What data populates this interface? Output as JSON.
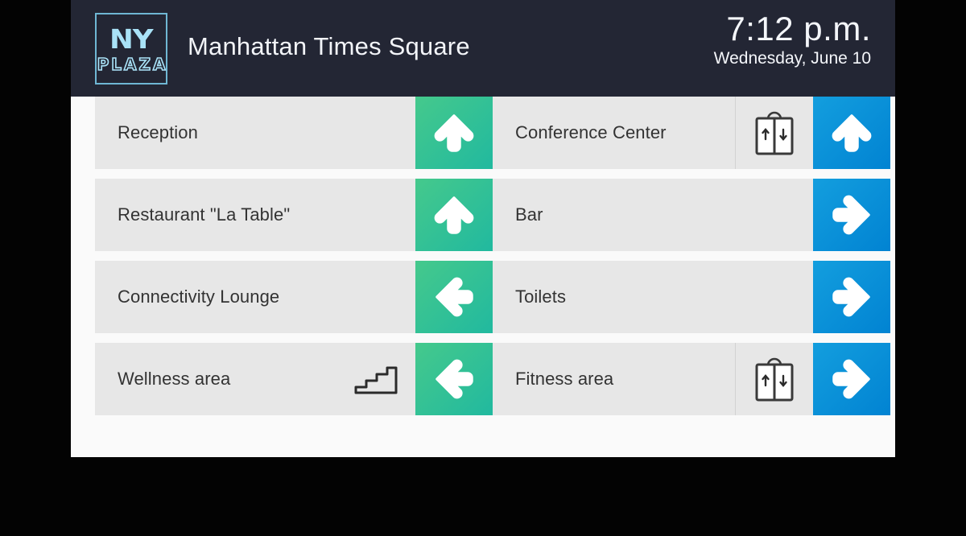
{
  "header": {
    "logo": {
      "line1": "NY",
      "line2": "PLAZA",
      "name": "ny-plaza-logo"
    },
    "venue_title": "Manhattan Times Square",
    "clock": {
      "time": "7:12 p.m.",
      "date": "Wednesday, June 10"
    },
    "background_color": "#232634",
    "logo_color": "#a9e2f7"
  },
  "colors": {
    "green_accent": "#2bbf96",
    "blue_accent": "#0a92d8",
    "row_background": "#e7e7e7",
    "panel_background": "#fafafa",
    "label_text": "#333333"
  },
  "directory": {
    "left_column": [
      {
        "label": "Reception",
        "icon": "none",
        "arrow": "up",
        "arrow_color": "green"
      },
      {
        "label": "Restaurant \"La Table\"",
        "icon": "none",
        "arrow": "up",
        "arrow_color": "green"
      },
      {
        "label": "Connectivity Lounge",
        "icon": "none",
        "arrow": "left",
        "arrow_color": "green"
      },
      {
        "label": "Wellness area",
        "icon": "stairs",
        "arrow": "left",
        "arrow_color": "green"
      }
    ],
    "right_column": [
      {
        "label": "Conference Center",
        "icon": "elevator",
        "arrow": "up",
        "arrow_color": "blue"
      },
      {
        "label": "Bar",
        "icon": "none",
        "arrow": "right",
        "arrow_color": "blue"
      },
      {
        "label": "Toilets",
        "icon": "none",
        "arrow": "right",
        "arrow_color": "blue"
      },
      {
        "label": "Fitness area",
        "icon": "elevator",
        "arrow": "right",
        "arrow_color": "blue"
      }
    ]
  }
}
